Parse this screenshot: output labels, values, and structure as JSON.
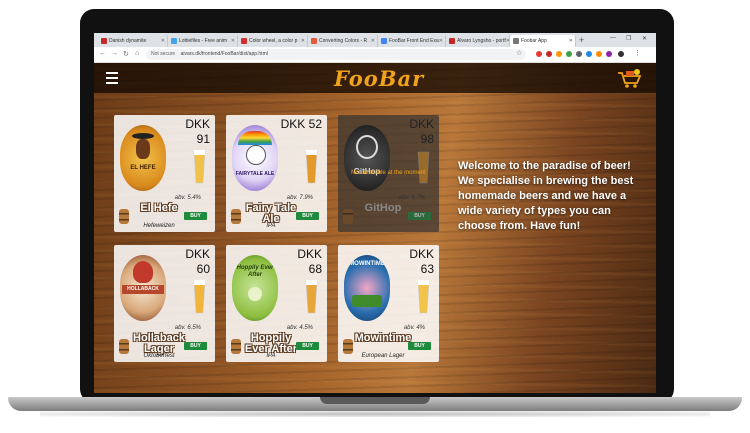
{
  "browser": {
    "tabs": [
      {
        "label": "Danish dynamite",
        "color": "#c62828"
      },
      {
        "label": "Lottiefiles - Free anim",
        "color": "#43a5e8"
      },
      {
        "label": "Color wheel, a color p",
        "color": "#d32f2f"
      },
      {
        "label": "Converting Colors - R",
        "color": "#e25b3a"
      },
      {
        "label": "FooBar Front End Exa",
        "color": "#4285f4"
      },
      {
        "label": "Alvaro Lyngsho - portf",
        "color": "#c62828"
      },
      {
        "label": "Foobar App",
        "color": "#777777"
      }
    ],
    "url_prefix": "Not secure",
    "url": "aivars.dk/frontend/FooBar/dist/app.html"
  },
  "header": {
    "logo": "FooBar"
  },
  "welcome_text": "Welcome to the paradise of beer! We specialise in brewing the best homemade beers and we have a wide variety of types you can choose from. Have fun!",
  "beers": [
    {
      "name": "El Hefe",
      "style": "Hefeweizen",
      "currency": "DKK",
      "price": "91",
      "abv": "abv. 5.4%",
      "available": true,
      "buy": "BUY",
      "label_color": "#e8a420",
      "label_text": "EL HEFE"
    },
    {
      "name": "Fairy Tale Ale",
      "style": "IPA",
      "currency": "DKK",
      "price": "52",
      "abv": "abv. 7.9%",
      "available": true,
      "buy": "BUY",
      "label_color": "#7a52c2",
      "label_text": "FAIRYTALE ALE"
    },
    {
      "name": "GitHop",
      "style": "IPA",
      "currency": "DKK",
      "price": "98",
      "abv": "abv. 6.7%",
      "available": false,
      "buy": "BUY",
      "label_color": "#2a2a2a",
      "label_text": "GitHop",
      "unavailable_text": "Not available at the moment"
    },
    {
      "name": "Hollaback Lager",
      "style": "Oktoberfest",
      "currency": "DKK",
      "price": "60",
      "abv": "abv. 6.5%",
      "available": true,
      "buy": "BUY",
      "label_color": "#b7472a",
      "label_text": "HOLLABACK"
    },
    {
      "name": "Hoppily Ever After",
      "style": "IPA",
      "currency": "DKK",
      "price": "68",
      "abv": "abv. 4.5%",
      "available": true,
      "buy": "BUY",
      "label_color": "#8cbf3f",
      "label_text": "Hoppily Ever After"
    },
    {
      "name": "Mowintime",
      "style": "European Lager",
      "currency": "DKK",
      "price": "63",
      "abv": "abv. 4%",
      "available": true,
      "buy": "BUY",
      "label_color": "#2a6fb0",
      "label_text": "MOWINTIME"
    }
  ]
}
